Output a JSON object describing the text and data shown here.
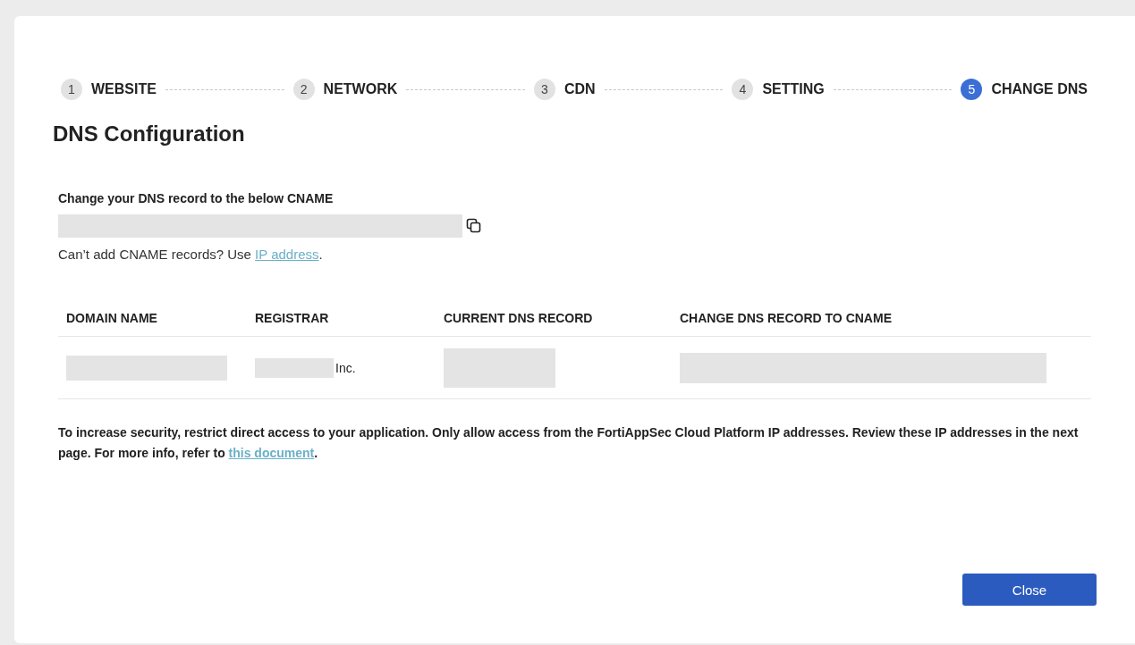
{
  "steps": [
    {
      "number": "1",
      "label": "WEBSITE",
      "selected": false
    },
    {
      "number": "2",
      "label": "NETWORK",
      "selected": false
    },
    {
      "number": "3",
      "label": "CDN",
      "selected": false
    },
    {
      "number": "4",
      "label": "SETTING",
      "selected": false
    },
    {
      "number": "5",
      "label": "CHANGE DNS",
      "selected": true
    }
  ],
  "title": "DNS Configuration",
  "cname": {
    "label": "Change your DNS record to the below CNAME",
    "alt_text": "Can’t add CNAME records? Use ",
    "alt_link": "IP address",
    "alt_end": "."
  },
  "table": {
    "columns": [
      "DOMAIN NAME",
      "REGISTRAR",
      "CURRENT DNS RECORD",
      "CHANGE DNS RECORD TO CNAME"
    ],
    "rows": [
      {
        "registrar_suffix": "Inc."
      }
    ]
  },
  "note": {
    "text": "To increase security, restrict direct access to your application. Only allow access from the FortiAppSec Cloud Platform IP addresses. Review these IP addresses in the next page. For more info, refer to ",
    "link": "this document",
    "end": "."
  },
  "buttons": {
    "close": "Close"
  }
}
